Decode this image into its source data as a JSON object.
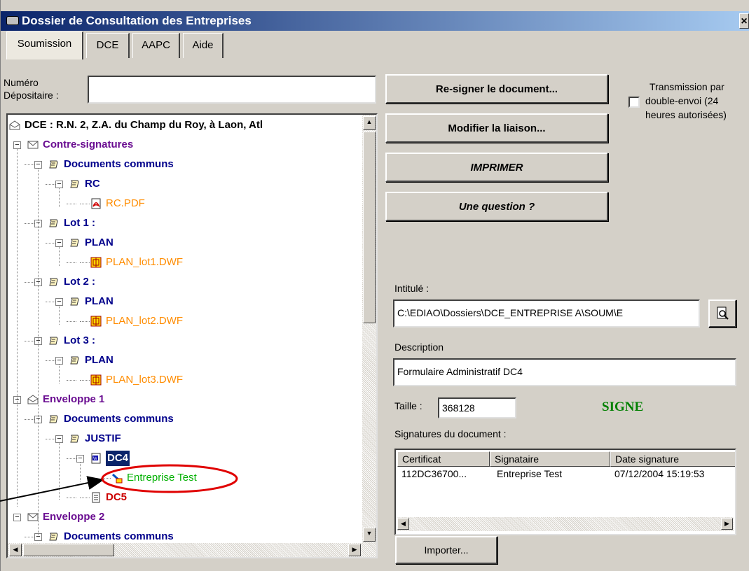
{
  "window": {
    "title": "Dossier de Consultation des Entreprises",
    "close": "×"
  },
  "tabs": [
    "Soumission",
    "DCE",
    "AAPC",
    "Aide"
  ],
  "form": {
    "numero_label_1": "Numéro",
    "numero_label_2": "Dépositaire :",
    "numero_value": "",
    "transmission_1": "Transmission par",
    "transmission_2": "double-envoi (24",
    "transmission_3": "heures autorisées)",
    "intitule_label": "Intitulé :",
    "intitule_value": "C:\\EDIAO\\Dossiers\\DCE_ENTREPRISE A\\SOUM\\E",
    "description_label": "Description",
    "description_value": "Formulaire Administratif DC4",
    "taille_label": "Taille :",
    "taille_value": "368128",
    "status": "SIGNE",
    "signatures_label": "Signatures du document :"
  },
  "buttons": {
    "resign": "Re-signer le document...",
    "modifier": "Modifier la liaison...",
    "imprimer": "IMPRIMER",
    "question": "Une question ?",
    "importer": "Importer..."
  },
  "tree": [
    {
      "text": "DCE : R.N. 2, Z.A. du Champ du Roy, à Laon, Atl",
      "color": "#000000",
      "icon": "envelope-open-icon"
    },
    {
      "text": "Contre-signatures",
      "color": "#6a0d91",
      "icon": "envelope-icon"
    },
    {
      "text": "Documents communs",
      "color": "#00008b",
      "icon": "scroll-icon"
    },
    {
      "text": "RC",
      "color": "#00008b",
      "icon": "scroll-icon"
    },
    {
      "text": "RC.PDF",
      "color": "#ff8c00",
      "icon": "pdf-icon"
    },
    {
      "text": "Lot 1 :",
      "color": "#00008b",
      "icon": "scroll-icon"
    },
    {
      "text": "PLAN",
      "color": "#00008b",
      "icon": "scroll-icon"
    },
    {
      "text": "PLAN_lot1.DWF",
      "color": "#ff8c00",
      "icon": "dwf-icon"
    },
    {
      "text": "Lot 2 :",
      "color": "#00008b",
      "icon": "scroll-icon"
    },
    {
      "text": "PLAN",
      "color": "#00008b",
      "icon": "scroll-icon"
    },
    {
      "text": "PLAN_lot2.DWF",
      "color": "#ff8c00",
      "icon": "dwf-icon"
    },
    {
      "text": "Lot 3 :",
      "color": "#00008b",
      "icon": "scroll-icon"
    },
    {
      "text": "PLAN",
      "color": "#00008b",
      "icon": "scroll-icon"
    },
    {
      "text": "PLAN_lot3.DWF",
      "color": "#ff8c00",
      "icon": "dwf-icon"
    },
    {
      "text": "Enveloppe 1",
      "color": "#6a0d91",
      "icon": "envelope-open-icon"
    },
    {
      "text": "Documents communs",
      "color": "#00008b",
      "icon": "scroll-icon"
    },
    {
      "text": "JUSTIF",
      "color": "#00008b",
      "icon": "scroll-icon"
    },
    {
      "text": "DC4",
      "color": "#ffffff",
      "icon": "word-icon"
    },
    {
      "text": "Entreprise Test",
      "color": "#00b000",
      "icon": "signature-icon"
    },
    {
      "text": "DC5",
      "color": "#cc0000",
      "icon": "document-icon"
    },
    {
      "text": "Enveloppe 2",
      "color": "#6a0d91",
      "icon": "envelope-icon"
    },
    {
      "text": "Documents communs",
      "color": "#00008b",
      "icon": "scroll-icon"
    }
  ],
  "signatures": {
    "columns": [
      "Certificat",
      "Signataire",
      "Date signature"
    ],
    "rows": [
      [
        "112DC36700...",
        "Entreprise Test",
        "07/12/2004 15:19:53"
      ]
    ]
  },
  "colors": {
    "status": "#008000",
    "highlight_oval": "#e00000",
    "selection": "#0a246a"
  }
}
